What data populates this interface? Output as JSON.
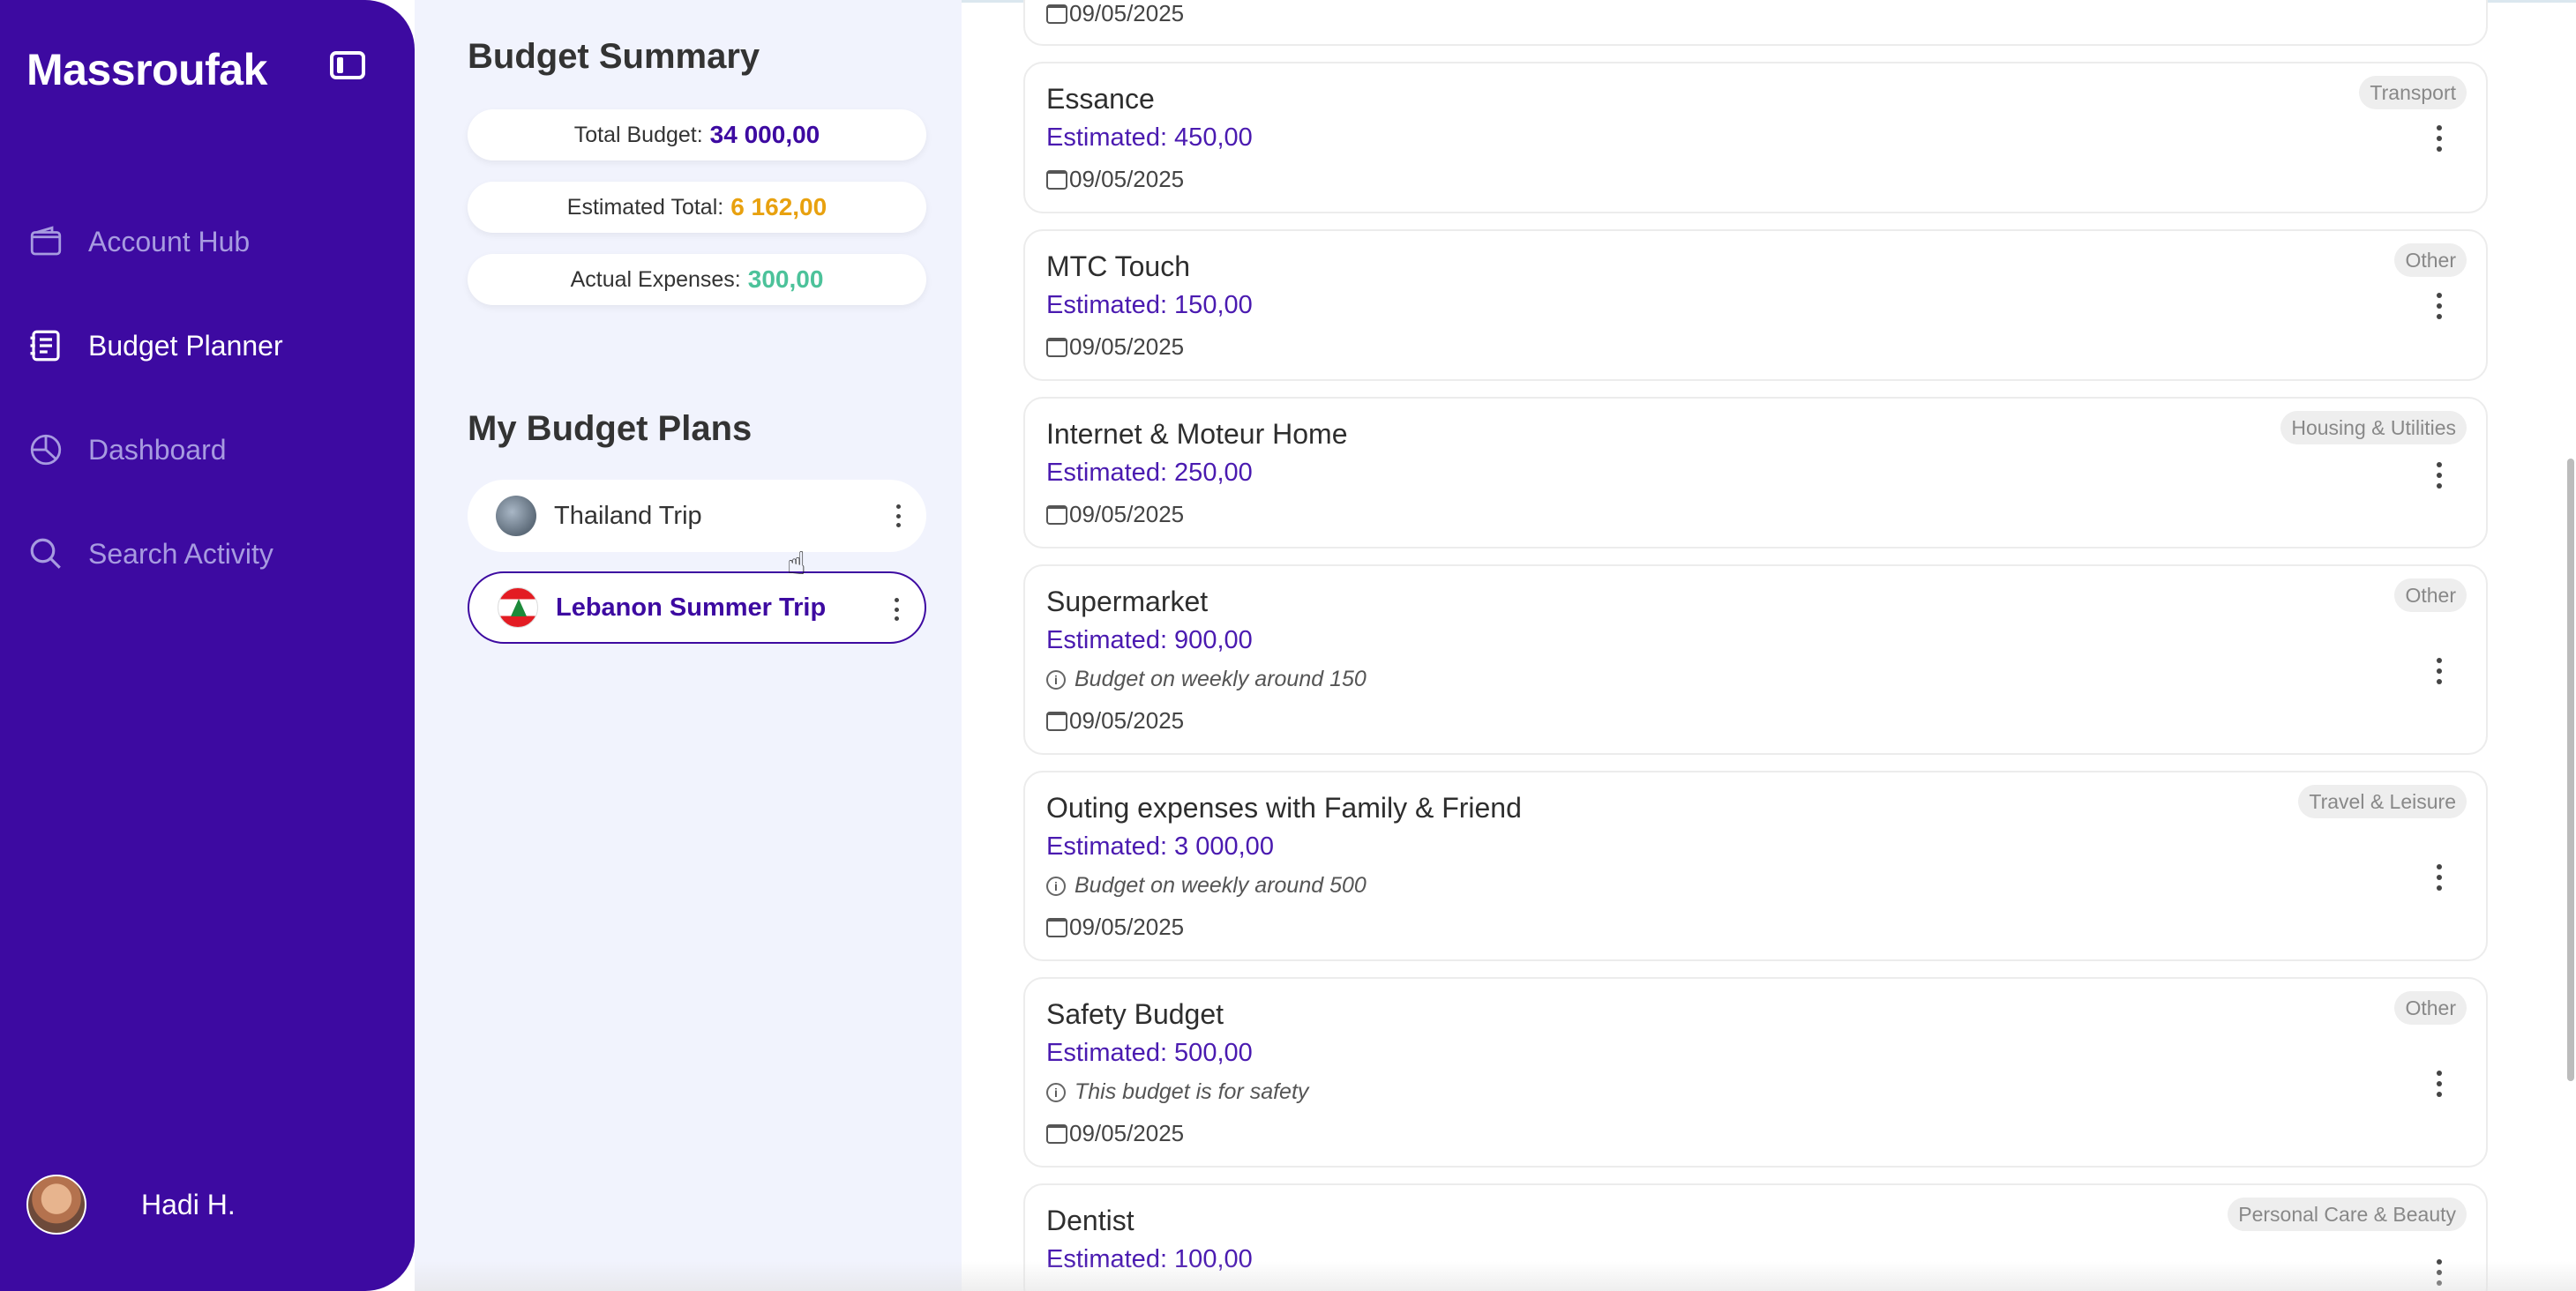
{
  "app": {
    "logo": "Massroufak"
  },
  "sidebar": {
    "items": [
      {
        "label": "Account Hub",
        "icon": "wallet-icon",
        "active": false
      },
      {
        "label": "Budget Planner",
        "icon": "planner-icon",
        "active": true
      },
      {
        "label": "Dashboard",
        "icon": "pie-chart-icon",
        "active": false
      },
      {
        "label": "Search Activity",
        "icon": "search-icon",
        "active": false
      }
    ],
    "user": {
      "name": "Hadi H."
    }
  },
  "summary": {
    "title": "Budget Summary",
    "total_budget_label": "Total Budget:",
    "total_budget_value": "34 000,00",
    "estimated_total_label": "Estimated Total:",
    "estimated_total_value": "6 162,00",
    "actual_expenses_label": "Actual Expenses:",
    "actual_expenses_value": "300,00"
  },
  "plans": {
    "title": "My Budget Plans",
    "items": [
      {
        "label": "Thailand Trip",
        "selected": false
      },
      {
        "label": "Lebanon Summer Trip",
        "selected": true
      }
    ]
  },
  "expenses": {
    "top_partial_date": "09/05/2025",
    "items": [
      {
        "name": "Essance",
        "estimated": "Estimated: 450,00",
        "note": "",
        "date": "09/05/2025",
        "category": "Transport"
      },
      {
        "name": "MTC Touch",
        "estimated": "Estimated: 150,00",
        "note": "",
        "date": "09/05/2025",
        "category": "Other"
      },
      {
        "name": "Internet & Moteur Home",
        "estimated": "Estimated: 250,00",
        "note": "",
        "date": "09/05/2025",
        "category": "Housing & Utilities"
      },
      {
        "name": "Supermarket",
        "estimated": "Estimated: 900,00",
        "note": "Budget on weekly around 150",
        "date": "09/05/2025",
        "category": "Other"
      },
      {
        "name": "Outing expenses with Family & Friend",
        "estimated": "Estimated: 3 000,00",
        "note": "Budget on weekly around 500",
        "date": "09/05/2025",
        "category": "Travel & Leisure"
      },
      {
        "name": "Safety Budget",
        "estimated": "Estimated: 500,00",
        "note": "This budget is for safety",
        "date": "09/05/2025",
        "category": "Other"
      },
      {
        "name": "Dentist",
        "estimated": "Estimated: 100,00",
        "note": "",
        "date": "",
        "category": "Personal Care & Beauty"
      }
    ]
  },
  "colors": {
    "sidebar_bg": "#3d0aa1",
    "accent": "#4a1ab0",
    "estimated_total": "#e8a10f",
    "actual_expenses": "#4cc29a"
  }
}
